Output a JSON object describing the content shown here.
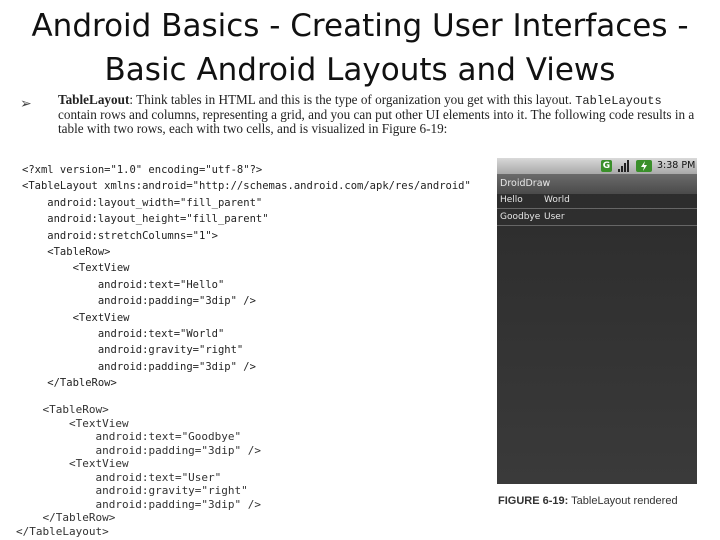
{
  "slide": {
    "title_line1": "Android Basics - Creating User Interfaces -",
    "title_line2": "Basic Android Layouts and Views",
    "bullet_symbol": "➢"
  },
  "paragraph": {
    "term": "TableLayout",
    "intro": ": Think tables in HTML and this is the type of organization you get with this layout. ",
    "code_term": "TableLayouts",
    "rest": " contain rows and columns, representing a grid, and you can put other UI elements into it. The following code results in a table with two rows, each with two cells, and is visualized in Figure 6-19:"
  },
  "code_block_1": [
    "<?xml version=\"1.0\" encoding=\"utf-8\"?>",
    "<TableLayout xmlns:android=\"http://schemas.android.com/apk/res/android\"",
    "    android:layout_width=\"fill_parent\"",
    "    android:layout_height=\"fill_parent\"",
    "    android:stretchColumns=\"1\">",
    "    <TableRow>",
    "        <TextView",
    "            android:text=\"Hello\"",
    "            android:padding=\"3dip\" />",
    "        <TextView",
    "            android:text=\"World\"",
    "            android:gravity=\"right\"",
    "            android:padding=\"3dip\" />",
    "    </TableRow>"
  ],
  "code_block_2": [
    "    <TableRow>",
    "        <TextView",
    "            android:text=\"Goodbye\"",
    "            android:padding=\"3dip\" />",
    "        <TextView",
    "            android:text=\"User\"",
    "            android:gravity=\"right\"",
    "            android:padding=\"3dip\" />",
    "    </TableRow>",
    "</TableLayout>"
  ],
  "phone": {
    "status_g": "G",
    "status_time": "3:38 PM",
    "app_title": "DroidDraw",
    "rows": [
      {
        "c1": "Hello",
        "c2": "World"
      },
      {
        "c1": "Goodbye",
        "c2": "User"
      }
    ]
  },
  "caption": {
    "figure": "FIGURE 6-19:",
    "text": " TableLayout rendered"
  },
  "colors": {
    "status_green": "#3a8f2a",
    "phone_background": "#2b2b2b"
  }
}
